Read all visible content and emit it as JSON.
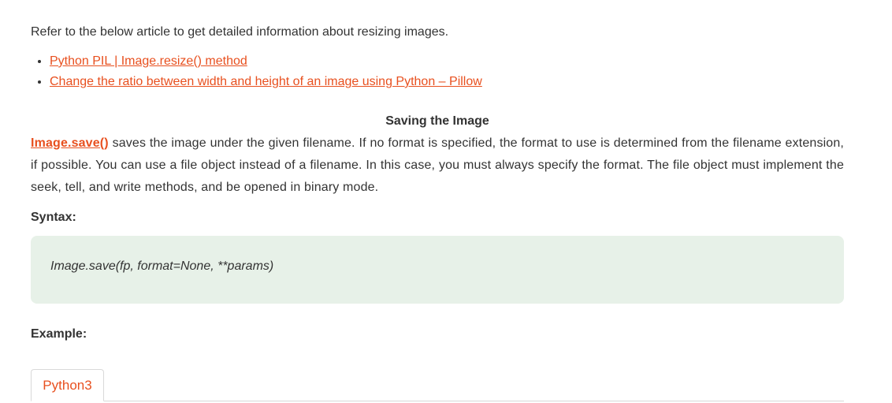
{
  "intro": "Refer to the below article to get detailed information about resizing images.",
  "links": [
    "Python PIL | Image.resize() method",
    "Change the ratio between width and height of an image using Python – Pillow"
  ],
  "section_title": "Saving the Image",
  "paragraph": {
    "link_text": "Image.save()",
    "text": " saves the image under the given filename. If no format is specified, the format to use is determined from the filename extension, if possible. You can use a file object instead of a filename. In this case, you must always specify the format. The file object must implement the seek, tell, and write methods, and be opened in binary mode."
  },
  "syntax_label": "Syntax:",
  "syntax_code": "Image.save(fp, format=None, **params)",
  "example_label": "Example:",
  "tabs": [
    {
      "label": "Python3"
    }
  ],
  "colors": {
    "link": "#e8501f",
    "code_bg": "#e7f1e8",
    "text": "#333333"
  }
}
